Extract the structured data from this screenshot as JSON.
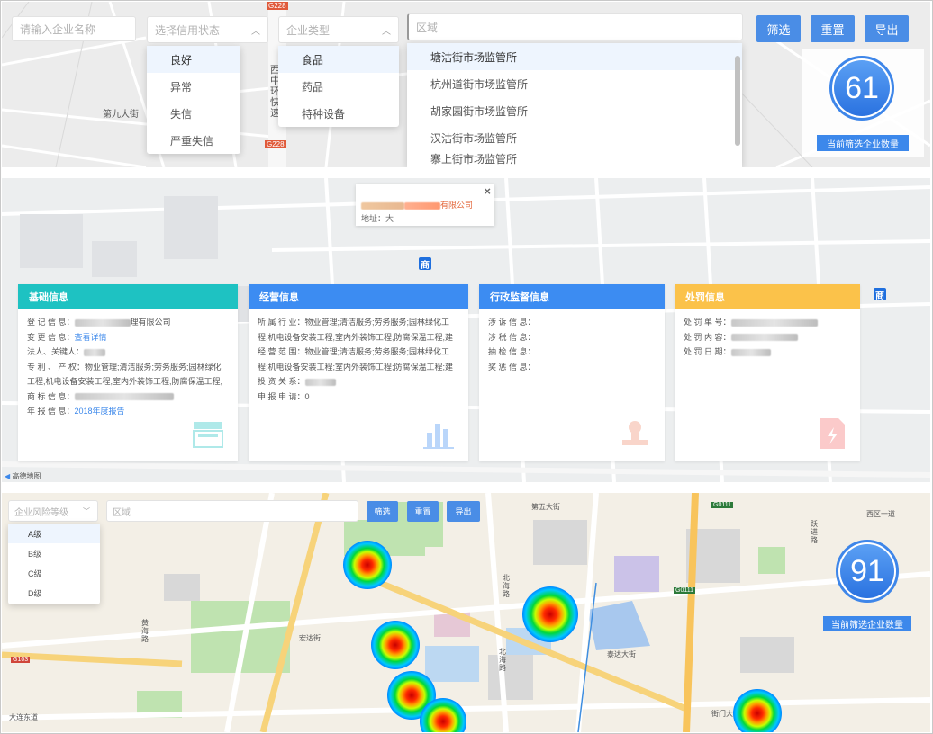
{
  "panel1": {
    "company_placeholder": "请输入企业名称",
    "credit_placeholder": "选择信用状态",
    "credit_options": [
      "良好",
      "异常",
      "失信",
      "严重失信"
    ],
    "type_placeholder": "企业类型",
    "type_options": [
      "食品",
      "药品",
      "特种设备"
    ],
    "region_placeholder": "区域",
    "region_options": [
      "塘沽街市场监管所",
      "杭州道街市场监管所",
      "胡家园街市场监管所",
      "汉沽街市场监管所",
      "寨上街市场监管所"
    ],
    "filter_label": "筛选",
    "reset_label": "重置",
    "export_label": "导出",
    "count": "61",
    "count_label": "当前筛选企业数量",
    "map_labels": {
      "g228_top": "G228",
      "g228_bottom": "G228",
      "road_vertical": "西中环快速",
      "road_left": "第九大街"
    }
  },
  "panel2": {
    "popup": {
      "title": "有限公司",
      "addr": "地址：大"
    },
    "shop_tag": "商",
    "attribution": "高德地图",
    "card_basic": {
      "title": "基础信息",
      "reg_label": "登 记 信 息：",
      "reg_value": "理有限公司",
      "chg_label": "变 更 信 息：",
      "chg_link": "查看详情",
      "legal_label": "法人、关键人：",
      "ip_label": "专 利 、 产 权：",
      "ip_value": "物业管理;清洁服务;劳务服务;园林绿化工程;机电设备安装工程;室内外装饰工程;防腐保温工程;建筑水暖安...",
      "tm_label": "商 标 信 息：",
      "ar_label": "年 报 信 息：",
      "ar_link": "2018年度报告",
      "color": "#1ec2c2"
    },
    "card_biz": {
      "title": "经营信息",
      "ind_label": "所 属 行 业：",
      "ind_value": "物业管理;清洁服务;劳务服务;园林绿化工程;机电设备安装工程;室内外装饰工程;防腐保温工程;建筑水暖安...",
      "scope_label": "经 营 范 围：",
      "scope_value": "物业管理;清洁服务;劳务服务;园林绿化工程;机电设备安装工程;室内外装饰工程;防腐保温工程;建筑水暖安...",
      "inv_label": "投 资 关 系：",
      "rep_label": "申 报 申 请：",
      "rep_value": "0",
      "color": "#3c8cf2"
    },
    "card_admin": {
      "title": "行政监督信息",
      "l1": "涉 诉 信 息：",
      "l2": "涉 税 信 息：",
      "l3": "抽 检 信 息：",
      "l4": "奖 惩 信 息：",
      "color": "#3c8cf2"
    },
    "card_penalty": {
      "title": "处罚信息",
      "l1": "处 罚 单 号：",
      "l2": "处 罚 内 容：",
      "l3": "处 罚 日 期：",
      "color": "#fbc24a"
    }
  },
  "panel3": {
    "risk_placeholder": "企业风险等级",
    "risk_options": [
      "A级",
      "B级",
      "C级",
      "D级"
    ],
    "region_placeholder": "区域",
    "filter_label": "筛选",
    "reset_label": "重置",
    "export_label": "导出",
    "count": "91",
    "count_label": "当前筛选企业数量",
    "map_labels": {
      "g0111_a": "G0111",
      "g0111_b": "G0111",
      "road1": "第五大街",
      "road2": "北海路",
      "road3": "北海路",
      "road4": "泰达大街",
      "road5": "西区一道",
      "road6": "跃进路",
      "road7": "黄海路",
      "road8": "大连东道",
      "road9": "宏达街",
      "road10": "街门大街",
      "road11": "G103"
    }
  },
  "colors": {
    "primary": "#4a8de6",
    "teal": "#1ec2c2",
    "blue": "#3c8cf2",
    "yellow": "#fbc24a"
  }
}
